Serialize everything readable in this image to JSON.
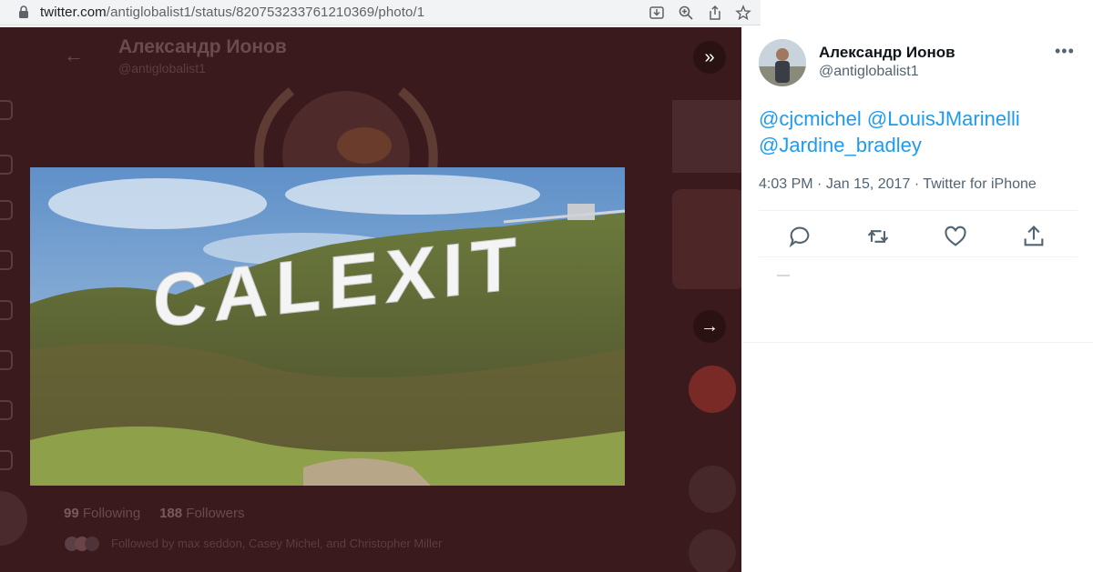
{
  "browser": {
    "url_host": "twitter.com",
    "url_path": "/antiglobalist1/status/820753233761210369/photo/1",
    "icons": [
      "lock-icon",
      "download-icon",
      "zoom-icon",
      "share-icon",
      "star-icon"
    ]
  },
  "background_profile": {
    "name": "Александр Ионов",
    "handle": "@antiglobalist1",
    "following_count": "99",
    "following_label": "Following",
    "followers_count": "188",
    "followers_label": "Followers",
    "followed_by": "Followed by max seddon, Casey Michel, and Christopher Miller"
  },
  "photo": {
    "sign_text": "CALEXIT"
  },
  "navigation": {
    "collapse_icon": "double-chevron-right-icon",
    "next_icon": "arrow-right-icon"
  },
  "tweet": {
    "display_name": "Александр Ионов",
    "handle": "@antiglobalist1",
    "mentions": [
      "@cjcmichel",
      "@LouisJMarinelli",
      "@Jardine_bradley"
    ],
    "time": "4:03 PM",
    "date": "Jan 15, 2017",
    "source": "Twitter for iPhone",
    "more_icon": "more-icon",
    "actions": [
      "reply-icon",
      "retweet-icon",
      "like-icon",
      "share-icon"
    ]
  },
  "colors": {
    "accent": "#1d9bf0",
    "text": "#0f1419",
    "secondary": "#536471",
    "overlay": "#3a1a1c"
  }
}
